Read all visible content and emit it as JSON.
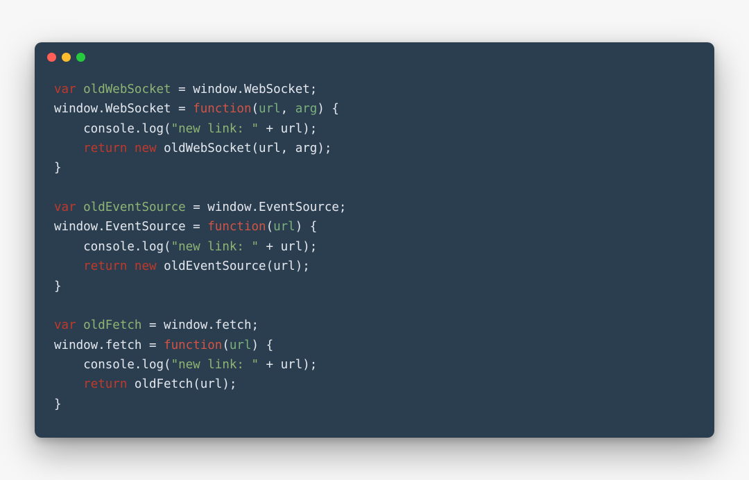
{
  "window": {
    "traffic_lights": [
      "red",
      "yellow",
      "green"
    ]
  },
  "code": {
    "tokens": [
      [
        [
          "kw",
          "var"
        ],
        [
          "id",
          " "
        ],
        [
          "decl",
          "oldWebSocket"
        ],
        [
          "id",
          " = window.WebSocket;"
        ]
      ],
      [
        [
          "id",
          "window.WebSocket = "
        ],
        [
          "fn",
          "function"
        ],
        [
          "id",
          "("
        ],
        [
          "arg",
          "url"
        ],
        [
          "id",
          ", "
        ],
        [
          "arg",
          "arg"
        ],
        [
          "id",
          ") {"
        ]
      ],
      [
        [
          "id",
          "    console.log("
        ],
        [
          "str",
          "\"new link: \""
        ],
        [
          "id",
          " + url);"
        ]
      ],
      [
        [
          "id",
          "    "
        ],
        [
          "kw",
          "return"
        ],
        [
          "id",
          " "
        ],
        [
          "kw",
          "new"
        ],
        [
          "id",
          " oldWebSocket(url, arg);"
        ]
      ],
      [
        [
          "id",
          "}"
        ]
      ],
      [],
      [
        [
          "kw",
          "var"
        ],
        [
          "id",
          " "
        ],
        [
          "decl",
          "oldEventSource"
        ],
        [
          "id",
          " = window.EventSource;"
        ]
      ],
      [
        [
          "id",
          "window.EventSource = "
        ],
        [
          "fn",
          "function"
        ],
        [
          "id",
          "("
        ],
        [
          "arg",
          "url"
        ],
        [
          "id",
          ") {"
        ]
      ],
      [
        [
          "id",
          "    console.log("
        ],
        [
          "str",
          "\"new link: \""
        ],
        [
          "id",
          " + url);"
        ]
      ],
      [
        [
          "id",
          "    "
        ],
        [
          "kw",
          "return"
        ],
        [
          "id",
          " "
        ],
        [
          "kw",
          "new"
        ],
        [
          "id",
          " oldEventSource(url);"
        ]
      ],
      [
        [
          "id",
          "}"
        ]
      ],
      [],
      [
        [
          "kw",
          "var"
        ],
        [
          "id",
          " "
        ],
        [
          "decl",
          "oldFetch"
        ],
        [
          "id",
          " = window.fetch;"
        ]
      ],
      [
        [
          "id",
          "window.fetch = "
        ],
        [
          "fn",
          "function"
        ],
        [
          "id",
          "("
        ],
        [
          "arg",
          "url"
        ],
        [
          "id",
          ") {"
        ]
      ],
      [
        [
          "id",
          "    console.log("
        ],
        [
          "str",
          "\"new link: \""
        ],
        [
          "id",
          " + url);"
        ]
      ],
      [
        [
          "id",
          "    "
        ],
        [
          "kw",
          "return"
        ],
        [
          "id",
          " oldFetch(url);"
        ]
      ],
      [
        [
          "id",
          "}"
        ]
      ]
    ]
  }
}
